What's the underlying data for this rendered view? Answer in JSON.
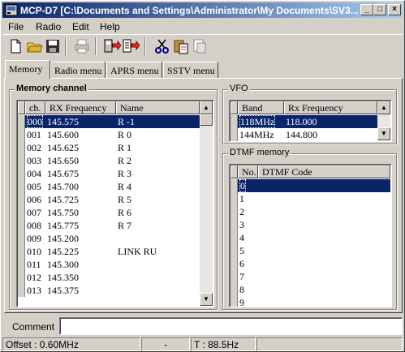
{
  "window": {
    "title": "MCP-D7 [C:\\Documents and Settings\\Administrator\\My Documents\\SV3..."
  },
  "menu": [
    "File",
    "Radio",
    "Edit",
    "Help"
  ],
  "toolbar": {
    "icons": [
      "new-file-icon",
      "open-folder-icon",
      "save-icon",
      "print-icon",
      "read-from-radio-icon",
      "write-to-radio-icon",
      "cut-icon",
      "paste-icon",
      "delete-icon"
    ]
  },
  "tabs": [
    "Memory",
    "Radio menu",
    "APRS menu",
    "SSTV menu"
  ],
  "memory": {
    "group_label": "Memory channel",
    "columns": [
      "ch.",
      "RX Frequency",
      "Name"
    ],
    "rows": [
      {
        "ch": "000",
        "freq": "145.575",
        "name": "R -1"
      },
      {
        "ch": "001",
        "freq": "145.600",
        "name": "R 0"
      },
      {
        "ch": "002",
        "freq": "145.625",
        "name": "R 1"
      },
      {
        "ch": "003",
        "freq": "145.650",
        "name": "R 2"
      },
      {
        "ch": "004",
        "freq": "145.675",
        "name": "R 3"
      },
      {
        "ch": "005",
        "freq": "145.700",
        "name": "R 4"
      },
      {
        "ch": "006",
        "freq": "145.725",
        "name": "R 5"
      },
      {
        "ch": "007",
        "freq": "145.750",
        "name": "R 6"
      },
      {
        "ch": "008",
        "freq": "145.775",
        "name": "R 7"
      },
      {
        "ch": "009",
        "freq": "145.200",
        "name": ""
      },
      {
        "ch": "010",
        "freq": "145.225",
        "name": "LINK RU"
      },
      {
        "ch": "011",
        "freq": "145.300",
        "name": ""
      },
      {
        "ch": "012",
        "freq": "145.350",
        "name": ""
      },
      {
        "ch": "013",
        "freq": "145.375",
        "name": ""
      }
    ]
  },
  "vfo": {
    "group_label": "VFO",
    "columns": [
      "Band",
      "Rx Frequency"
    ],
    "rows": [
      {
        "band": "118MHz",
        "freq": "118.000"
      },
      {
        "band": "144MHz",
        "freq": "144.800"
      }
    ]
  },
  "dtmf": {
    "group_label": "DTMF memory",
    "columns": [
      "No.",
      "DTMF Code"
    ],
    "rows": [
      "0",
      "1",
      "2",
      "3",
      "4",
      "5",
      "6",
      "7",
      "8",
      "9"
    ]
  },
  "comment": {
    "label": "Comment",
    "value": ""
  },
  "status": {
    "offset": "Offset : 0.60MHz",
    "mode": "-",
    "tone": "T : 88.5Hz"
  },
  "colors": {
    "selection": "#0a246a",
    "face": "#d4d0c8",
    "title_start": "#0a246a",
    "title_end": "#a6caf0"
  }
}
